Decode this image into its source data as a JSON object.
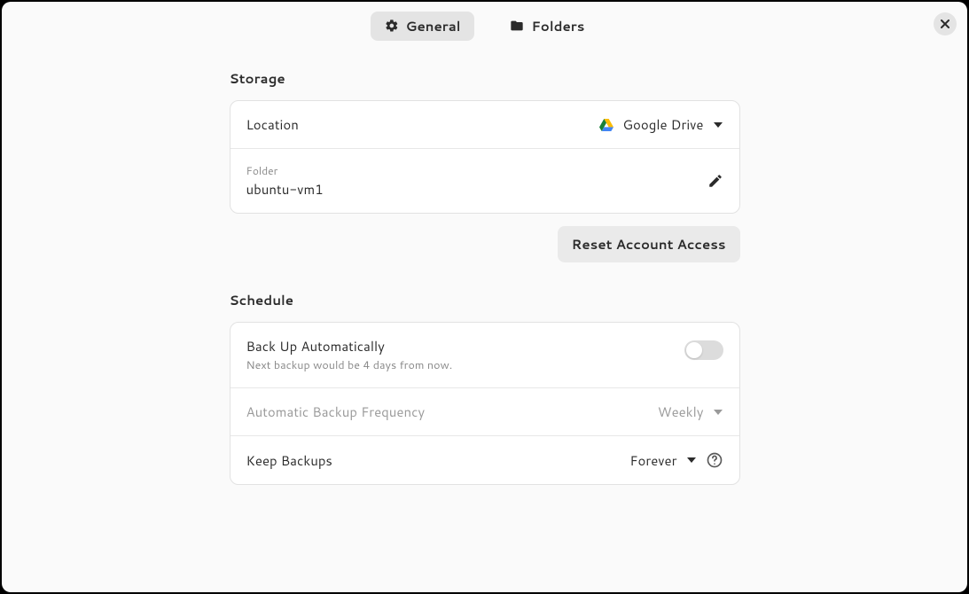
{
  "header": {
    "tabs": {
      "general": "General",
      "folders": "Folders"
    }
  },
  "storage": {
    "title": "Storage",
    "location_label": "Location",
    "location_value": "Google Drive",
    "folder_small_label": "Folder",
    "folder_value": "ubuntu-vm1",
    "reset_button": "Reset Account Access"
  },
  "schedule": {
    "title": "Schedule",
    "auto_label": "Back Up Automatically",
    "auto_sub": "Next backup would be 4 days from now.",
    "freq_label": "Automatic Backup Frequency",
    "freq_value": "Weekly",
    "keep_label": "Keep Backups",
    "keep_value": "Forever"
  }
}
